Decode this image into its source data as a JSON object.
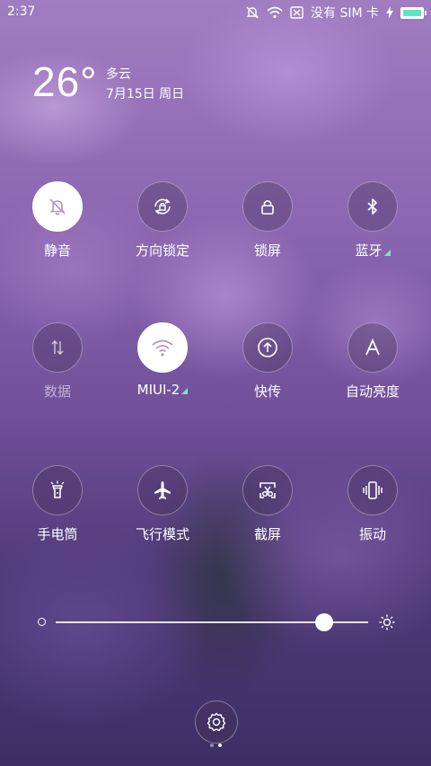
{
  "status_bar": {
    "time": "2:37",
    "signal_text": "没有 SIM 卡"
  },
  "weather": {
    "temperature": "26°",
    "condition": "多云",
    "date": "7月15日 周日"
  },
  "toggles": [
    {
      "label": "静音",
      "icon": "mute-bell-icon",
      "active": true
    },
    {
      "label": "方向锁定",
      "icon": "rotation-lock-icon",
      "active": false
    },
    {
      "label": "锁屏",
      "icon": "lock-icon",
      "active": false
    },
    {
      "label": "蓝牙",
      "icon": "bluetooth-icon",
      "active": false
    },
    {
      "label": "数据",
      "icon": "data-arrows-icon",
      "active": false
    },
    {
      "label": "MIUI-2",
      "icon": "wifi-icon",
      "active": true
    },
    {
      "label": "快传",
      "icon": "upload-icon",
      "active": false
    },
    {
      "label": "自动亮度",
      "icon": "auto-brightness-a-icon",
      "active": false
    },
    {
      "label": "手电筒",
      "icon": "flashlight-icon",
      "active": false
    },
    {
      "label": "飞行模式",
      "icon": "airplane-icon",
      "active": false
    },
    {
      "label": "截屏",
      "icon": "screenshot-scissors-icon",
      "active": false
    },
    {
      "label": "振动",
      "icon": "vibrate-icon",
      "active": false
    }
  ],
  "brightness": {
    "level": 0.86
  },
  "colors": {
    "accent_teal": "#7de3d0",
    "battery_fill": "#5fe3c6"
  }
}
